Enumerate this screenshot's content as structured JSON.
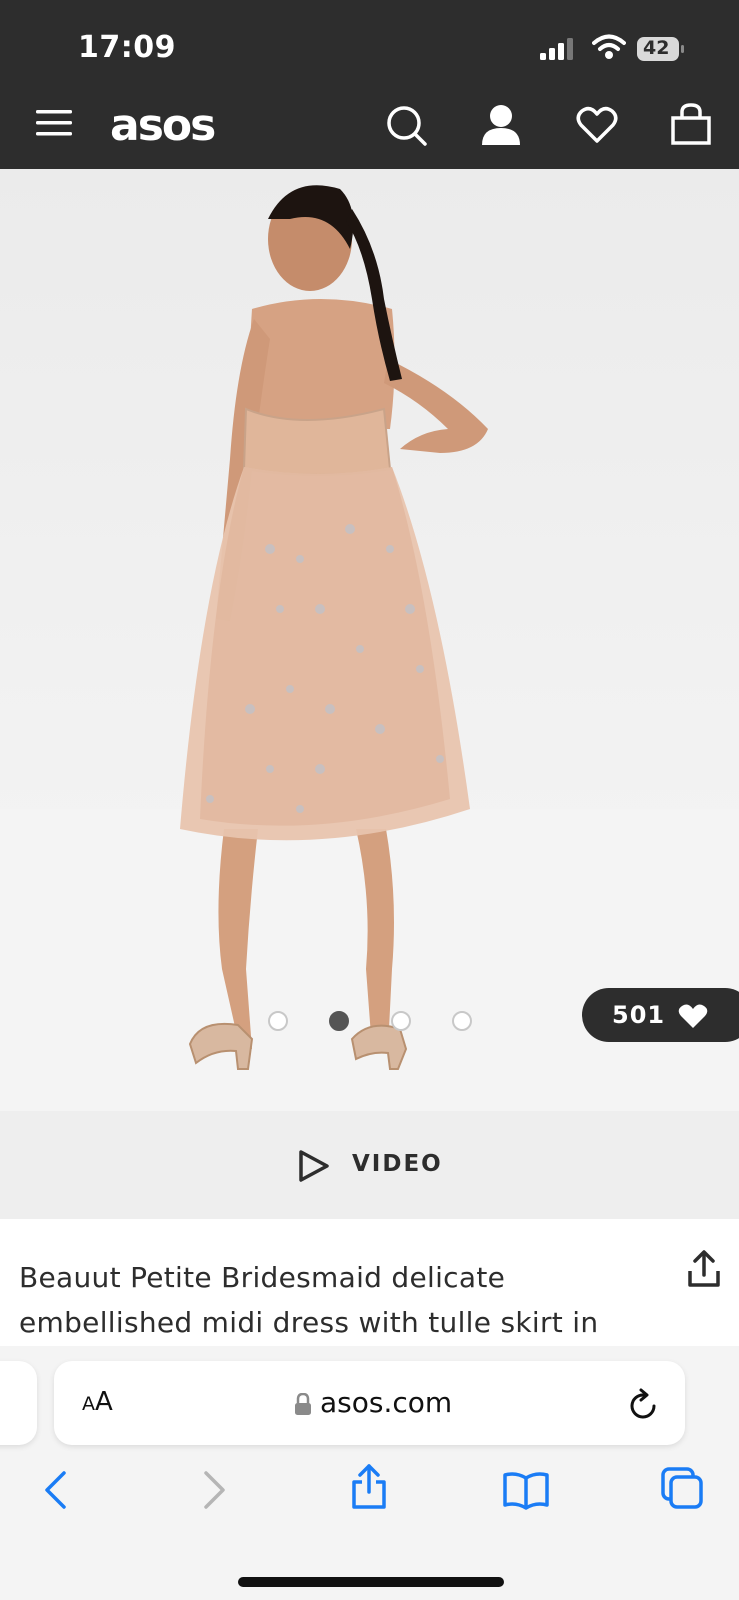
{
  "status_bar": {
    "time": "17:09",
    "battery": "42"
  },
  "nav": {
    "logo": "asos"
  },
  "product": {
    "like_count": "501",
    "video_label": "VIDEO",
    "title": "Beauut Petite Bridesmaid delicate embellished midi dress with tulle skirt in taupe",
    "carousel": {
      "total": 4,
      "active_index": 2
    }
  },
  "browser": {
    "text_size_label_small": "A",
    "text_size_label_large": "A",
    "url": "asos.com"
  },
  "colors": {
    "nav_bg": "#2d2d2d",
    "safari_blue": "#1a7cf5",
    "dress": "#e3bfa8"
  },
  "icons": [
    "menu-icon",
    "search-icon",
    "account-icon",
    "wishlist-icon",
    "bag-icon",
    "heart-icon",
    "play-icon",
    "share-icon",
    "lock-icon",
    "reload-icon",
    "back-icon",
    "forward-icon",
    "safari-share-icon",
    "bookmarks-icon",
    "tabs-icon"
  ]
}
